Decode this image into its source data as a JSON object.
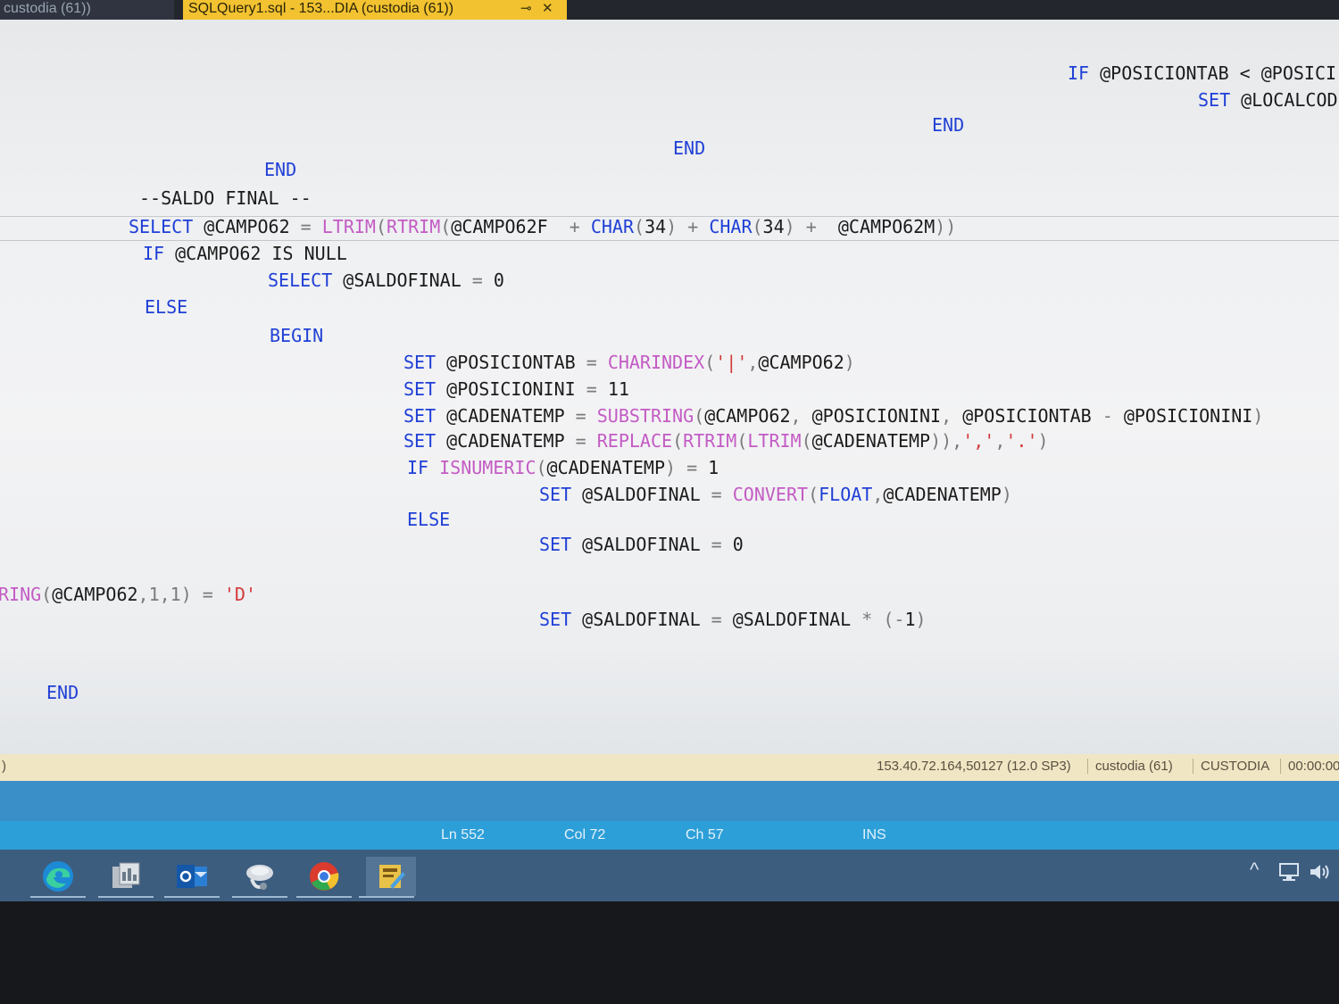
{
  "tabs": {
    "inactive_label": "custodia (61))",
    "active_label": "SQLQuery1.sql - 153...DIA (custodia (61))",
    "pin_glyph": "⊸",
    "close_glyph": "✕"
  },
  "editor": {
    "lines": [
      [
        {
          "t": "IF ",
          "c": "kw"
        },
        {
          "t": "@POSICIONTAB < @POSICI",
          "c": "cm"
        }
      ],
      [
        {
          "t": "SET ",
          "c": "kw"
        },
        {
          "t": "@LOCALCOD",
          "c": "cm"
        }
      ],
      [
        {
          "t": "END",
          "c": "kw"
        }
      ],
      [
        {
          "t": "END",
          "c": "kw"
        }
      ],
      [
        {
          "t": "END",
          "c": "kw"
        }
      ],
      [
        {
          "t": "--SALDO FINAL --",
          "c": "cm"
        }
      ],
      [
        {
          "t": "SELECT ",
          "c": "kw"
        },
        {
          "t": "@CAMPO62 ",
          "c": "cm"
        },
        {
          "t": "= ",
          "c": "op"
        },
        {
          "t": "LTRIM",
          "c": "fn"
        },
        {
          "t": "(",
          "c": "op"
        },
        {
          "t": "RTRIM",
          "c": "fn"
        },
        {
          "t": "(",
          "c": "op"
        },
        {
          "t": "@CAMPO62F  ",
          "c": "cm"
        },
        {
          "t": "+ ",
          "c": "op"
        },
        {
          "t": "CHAR",
          "c": "kw"
        },
        {
          "t": "(",
          "c": "op"
        },
        {
          "t": "34",
          "c": "cm"
        },
        {
          "t": ") + ",
          "c": "op"
        },
        {
          "t": "CHAR",
          "c": "kw"
        },
        {
          "t": "(",
          "c": "op"
        },
        {
          "t": "34",
          "c": "cm"
        },
        {
          "t": ") +  ",
          "c": "op"
        },
        {
          "t": "@CAMPO62M",
          "c": "cm"
        },
        {
          "t": "))",
          "c": "op"
        }
      ],
      [
        {
          "t": "IF ",
          "c": "kw"
        },
        {
          "t": "@CAMPO62 IS NULL",
          "c": "cm"
        }
      ],
      [
        {
          "t": "SELECT ",
          "c": "kw"
        },
        {
          "t": "@SALDOFINAL ",
          "c": "cm"
        },
        {
          "t": "= ",
          "c": "op"
        },
        {
          "t": "0",
          "c": "cm"
        }
      ],
      [
        {
          "t": "ELSE",
          "c": "kw"
        }
      ],
      [
        {
          "t": "BEGIN",
          "c": "kw"
        }
      ],
      [
        {
          "t": "SET ",
          "c": "kw"
        },
        {
          "t": "@POSICIONTAB ",
          "c": "cm"
        },
        {
          "t": "= ",
          "c": "op"
        },
        {
          "t": "CHARINDEX",
          "c": "fn"
        },
        {
          "t": "(",
          "c": "op"
        },
        {
          "t": "'|'",
          "c": "str"
        },
        {
          "t": ",",
          "c": "op"
        },
        {
          "t": "@CAMPO62",
          "c": "cm"
        },
        {
          "t": ")",
          "c": "op"
        }
      ],
      [
        {
          "t": "SET ",
          "c": "kw"
        },
        {
          "t": "@POSICIONINI ",
          "c": "cm"
        },
        {
          "t": "= ",
          "c": "op"
        },
        {
          "t": "11",
          "c": "cm"
        }
      ],
      [
        {
          "t": "SET ",
          "c": "kw"
        },
        {
          "t": "@CADENATEMP ",
          "c": "cm"
        },
        {
          "t": "= ",
          "c": "op"
        },
        {
          "t": "SUBSTRING",
          "c": "fn"
        },
        {
          "t": "(",
          "c": "op"
        },
        {
          "t": "@CAMPO62",
          "c": "cm"
        },
        {
          "t": ", ",
          "c": "op"
        },
        {
          "t": "@POSICIONINI",
          "c": "cm"
        },
        {
          "t": ", ",
          "c": "op"
        },
        {
          "t": "@POSICIONTAB ",
          "c": "cm"
        },
        {
          "t": "- ",
          "c": "op"
        },
        {
          "t": "@POSICIONINI",
          "c": "cm"
        },
        {
          "t": ")",
          "c": "op"
        }
      ],
      [
        {
          "t": "SET ",
          "c": "kw"
        },
        {
          "t": "@CADENATEMP ",
          "c": "cm"
        },
        {
          "t": "= ",
          "c": "op"
        },
        {
          "t": "REPLACE",
          "c": "fn"
        },
        {
          "t": "(",
          "c": "op"
        },
        {
          "t": "RTRIM",
          "c": "fn"
        },
        {
          "t": "(",
          "c": "op"
        },
        {
          "t": "LTRIM",
          "c": "fn"
        },
        {
          "t": "(",
          "c": "op"
        },
        {
          "t": "@CADENATEMP",
          "c": "cm"
        },
        {
          "t": ")),",
          "c": "op"
        },
        {
          "t": "','",
          "c": "str"
        },
        {
          "t": ",",
          "c": "op"
        },
        {
          "t": "'.'",
          "c": "str"
        },
        {
          "t": ")",
          "c": "op"
        }
      ],
      [
        {
          "t": "IF ",
          "c": "kw"
        },
        {
          "t": "ISNUMERIC",
          "c": "fn"
        },
        {
          "t": "(",
          "c": "op"
        },
        {
          "t": "@CADENATEMP",
          "c": "cm"
        },
        {
          "t": ") = ",
          "c": "op"
        },
        {
          "t": "1",
          "c": "cm"
        }
      ],
      [
        {
          "t": "SET ",
          "c": "kw"
        },
        {
          "t": "@SALDOFINAL ",
          "c": "cm"
        },
        {
          "t": "= ",
          "c": "op"
        },
        {
          "t": "CONVERT",
          "c": "fn"
        },
        {
          "t": "(",
          "c": "op"
        },
        {
          "t": "FLOAT",
          "c": "kw"
        },
        {
          "t": ",",
          "c": "op"
        },
        {
          "t": "@CADENATEMP",
          "c": "cm"
        },
        {
          "t": ")",
          "c": "op"
        }
      ],
      [
        {
          "t": "ELSE",
          "c": "kw"
        }
      ],
      [
        {
          "t": "SET ",
          "c": "kw"
        },
        {
          "t": "@SALDOFINAL ",
          "c": "cm"
        },
        {
          "t": "= ",
          "c": "op"
        },
        {
          "t": "0",
          "c": "cm"
        }
      ],
      [
        {
          "t": "RING",
          "c": "fn"
        },
        {
          "t": "(",
          "c": "op"
        },
        {
          "t": "@CAMPO62",
          "c": "cm"
        },
        {
          "t": ",1,1) = ",
          "c": "op"
        },
        {
          "t": "'D'",
          "c": "str"
        }
      ],
      [
        {
          "t": "SET ",
          "c": "kw"
        },
        {
          "t": "@SALDOFINAL ",
          "c": "cm"
        },
        {
          "t": "= ",
          "c": "op"
        },
        {
          "t": "@SALDOFINAL ",
          "c": "cm"
        },
        {
          "t": "* (-",
          "c": "op"
        },
        {
          "t": "1",
          "c": "cm"
        },
        {
          "t": ")",
          "c": "op"
        }
      ],
      [
        {
          "t": "END",
          "c": "kw"
        }
      ]
    ]
  },
  "connection_bar": {
    "left_fragment": ")",
    "server": "153.40.72.164,50127 (12.0 SP3)",
    "login": "custodia (61)",
    "database": "CUSTODIA",
    "time": "00:00:00"
  },
  "status_bar": {
    "line": "Ln 552",
    "column": "Col 72",
    "char": "Ch 57",
    "mode": "INS"
  },
  "taskbar": {
    "apps": [
      "edge-icon",
      "ssms-icon",
      "outlook-icon",
      "remote-desktop-icon",
      "chrome-icon",
      "sql-query-icon"
    ],
    "tray": [
      "chevron-up-icon",
      "network-icon",
      "volume-icon"
    ]
  },
  "colors": {
    "keyword": "#1f3fd6",
    "function": "#c35bc4",
    "string": "#d23a3a",
    "operator": "#7a7a7a",
    "status_bar": "#2d9fd8",
    "taskbar": "#3d5d7f",
    "active_tab": "#f2c230"
  }
}
